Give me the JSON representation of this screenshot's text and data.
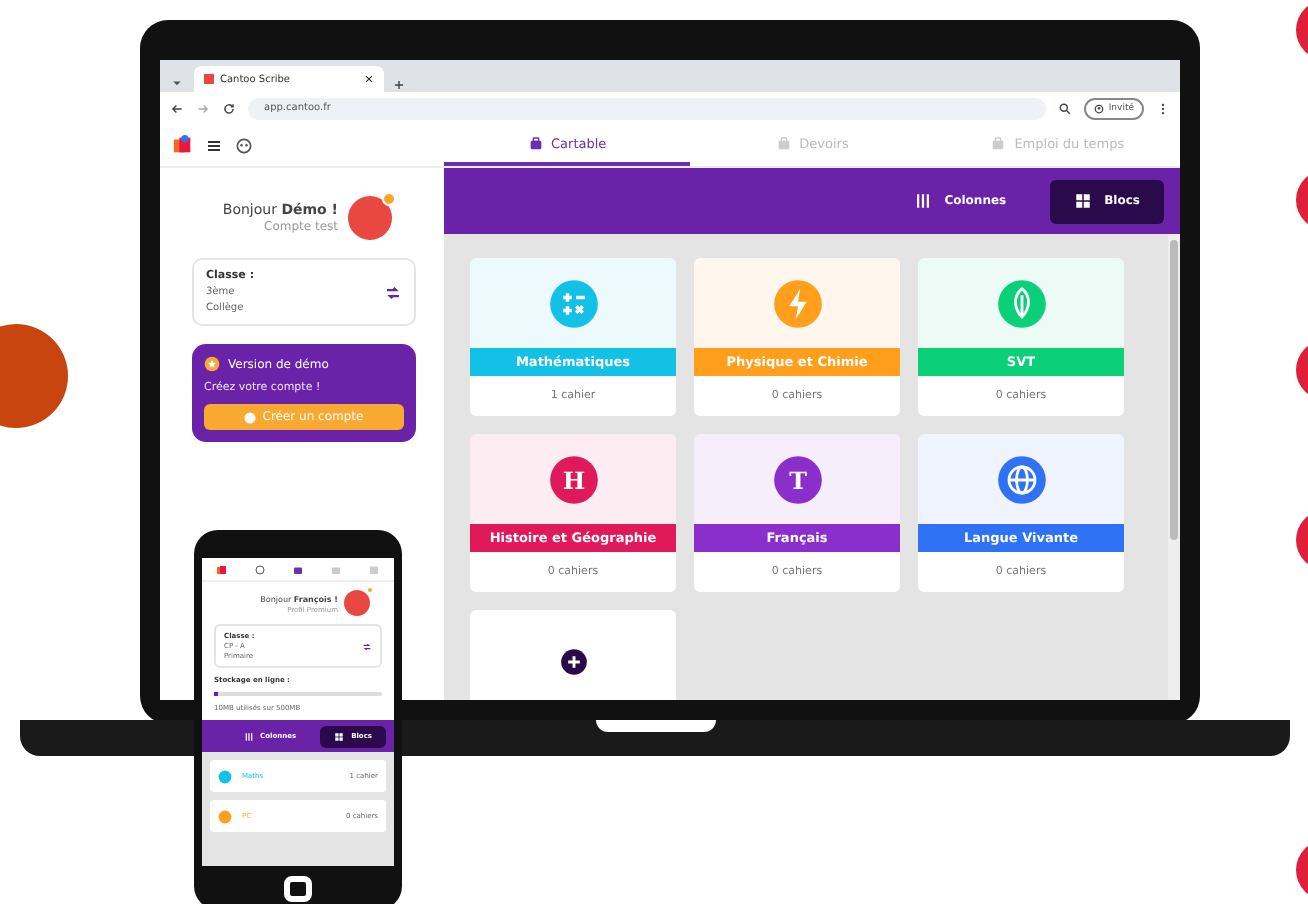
{
  "browser": {
    "tab_title": "Cantoo Scribe",
    "url": "app.cantoo.fr",
    "profile_label": "Invité"
  },
  "nav_tabs": [
    {
      "label": "Cartable",
      "selected": true
    },
    {
      "label": "Devoirs",
      "selected": false
    },
    {
      "label": "Emploi du temps",
      "selected": false
    }
  ],
  "sidebar": {
    "greeting": "Bonjour **Démo !**",
    "subtitle": "Compte test",
    "class_card": {
      "label": "Classe :",
      "lines": [
        "3ème",
        "Collège"
      ]
    },
    "demo_card": {
      "title": "Version de démo",
      "text": "Créez votre compte !",
      "button": "Créer un compte"
    }
  },
  "view_toggle": [
    {
      "label": "Colonnes",
      "kind": "columns",
      "selected": false
    },
    {
      "label": "Blocs",
      "kind": "blocks",
      "selected": true
    }
  ],
  "subjects": [
    {
      "name": "Mathématiques",
      "count": "1 cahier",
      "color": "#13c0e6",
      "kind": "math"
    },
    {
      "name": "Physique et Chimie",
      "count": "0 cahiers",
      "color": "#ff9f1c",
      "kind": "bolt"
    },
    {
      "name": "SVT",
      "count": "0 cahiers",
      "color": "#0ccf7a",
      "kind": "leaf"
    },
    {
      "name": "Histoire et Géographie",
      "count": "0 cahiers",
      "color": "#e0195a",
      "kind": "letter",
      "letter": "H"
    },
    {
      "name": "Français",
      "count": "0 cahiers",
      "color": "#8a2fcc",
      "kind": "letter",
      "letter": "T"
    },
    {
      "name": "Langue Vivante",
      "count": "0 cahiers",
      "color": "#2f72f5",
      "kind": "globe"
    }
  ],
  "phone": {
    "greeting": "Bonjour **François !**",
    "subtitle": "Profil Premium",
    "class_card": {
      "label": "Classe :",
      "lines": [
        "CP - A",
        "Primaire"
      ]
    },
    "storage": {
      "label": "Stockage en ligne :",
      "level": 0.02,
      "reading": "10MB utilisés sur 500MB"
    },
    "view_toggle": [
      {
        "label": "Colonnes",
        "kind": "columns",
        "selected": false
      },
      {
        "label": "Blocs",
        "kind": "blocks",
        "selected": true
      }
    ],
    "subjects": [
      {
        "name": "Maths",
        "count": "1 cahier",
        "color": "#13c0e6"
      },
      {
        "name": "PC",
        "count": "0 cahiers",
        "color": "#ff9f1c"
      }
    ]
  }
}
